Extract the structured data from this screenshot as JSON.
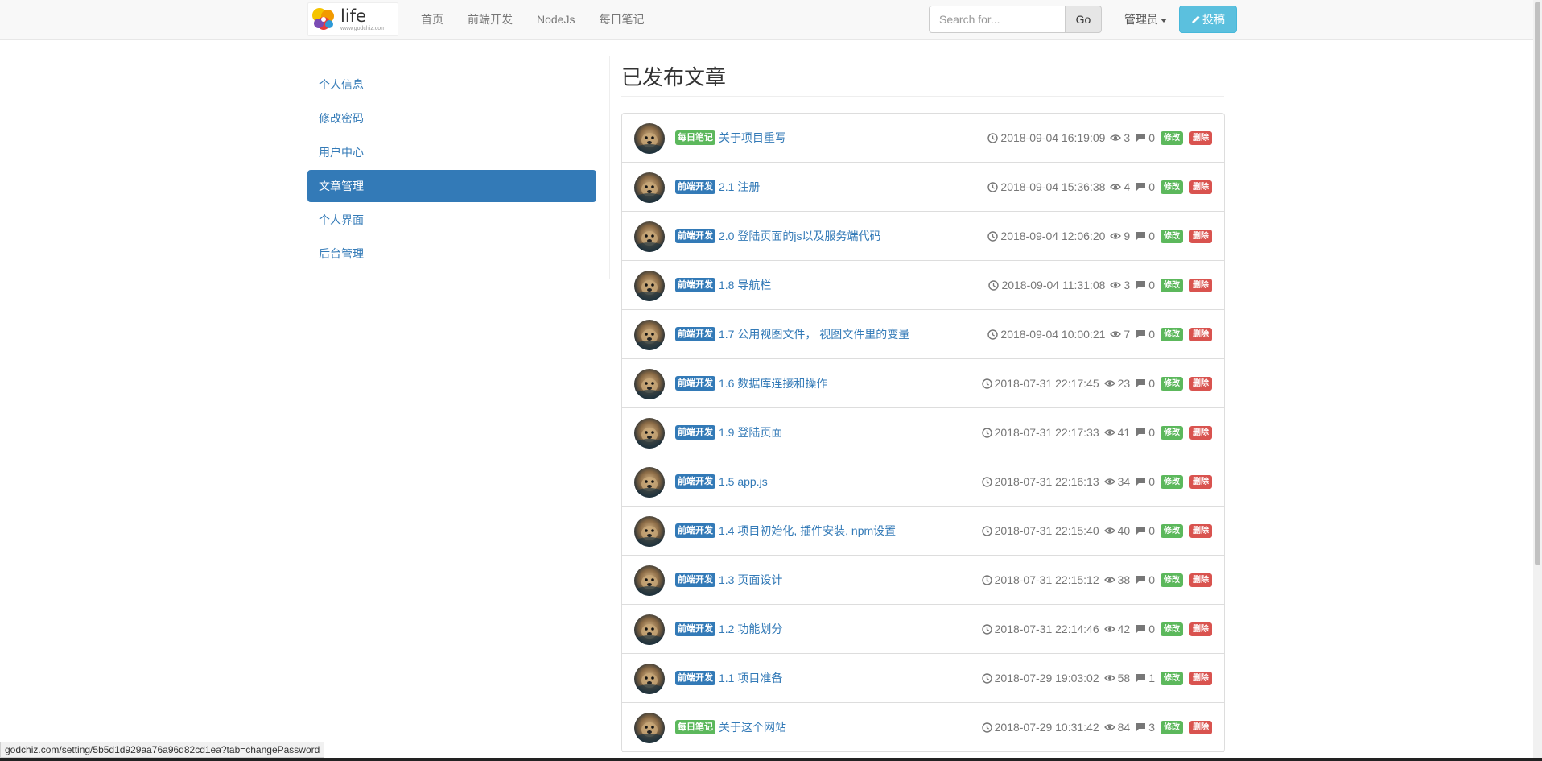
{
  "navbar": {
    "logo_text": "life",
    "logo_sub": "www.godchiz.com",
    "links": [
      "首页",
      "前端开发",
      "NodeJs",
      "每日笔记"
    ],
    "search_placeholder": "Search for...",
    "go_label": "Go",
    "admin_label": "管理员",
    "post_label": "投稿"
  },
  "sidebar": {
    "items": [
      {
        "label": "个人信息"
      },
      {
        "label": "修改密码"
      },
      {
        "label": "用户中心"
      },
      {
        "label": "文章管理",
        "active": true
      },
      {
        "label": "个人界面"
      },
      {
        "label": "后台管理"
      }
    ]
  },
  "main": {
    "title": "已发布文章",
    "edit_label": "修改",
    "delete_label": "删除",
    "posts": [
      {
        "category": "每日笔记",
        "cat_color": "green",
        "title": "关于项目重写",
        "date": "2018-09-04 16:19:09",
        "views": "3",
        "comments": "0"
      },
      {
        "category": "前端开发",
        "cat_color": "blue",
        "title": "2.1 注册",
        "date": "2018-09-04 15:36:38",
        "views": "4",
        "comments": "0"
      },
      {
        "category": "前端开发",
        "cat_color": "blue",
        "title": "2.0 登陆页面的js以及服务端代码",
        "date": "2018-09-04 12:06:20",
        "views": "9",
        "comments": "0"
      },
      {
        "category": "前端开发",
        "cat_color": "blue",
        "title": "1.8 导航栏",
        "date": "2018-09-04 11:31:08",
        "views": "3",
        "comments": "0"
      },
      {
        "category": "前端开发",
        "cat_color": "blue",
        "title": "1.7 公用视图文件， 视图文件里的变量",
        "date": "2018-09-04 10:00:21",
        "views": "7",
        "comments": "0"
      },
      {
        "category": "前端开发",
        "cat_color": "blue",
        "title": "1.6 数据库连接和操作",
        "date": "2018-07-31 22:17:45",
        "views": "23",
        "comments": "0"
      },
      {
        "category": "前端开发",
        "cat_color": "blue",
        "title": "1.9 登陆页面",
        "date": "2018-07-31 22:17:33",
        "views": "41",
        "comments": "0"
      },
      {
        "category": "前端开发",
        "cat_color": "blue",
        "title": "1.5 app.js",
        "date": "2018-07-31 22:16:13",
        "views": "34",
        "comments": "0"
      },
      {
        "category": "前端开发",
        "cat_color": "blue",
        "title": "1.4 项目初始化, 插件安装, npm设置",
        "date": "2018-07-31 22:15:40",
        "views": "40",
        "comments": "0"
      },
      {
        "category": "前端开发",
        "cat_color": "blue",
        "title": "1.3 页面设计",
        "date": "2018-07-31 22:15:12",
        "views": "38",
        "comments": "0"
      },
      {
        "category": "前端开发",
        "cat_color": "blue",
        "title": "1.2 功能划分",
        "date": "2018-07-31 22:14:46",
        "views": "42",
        "comments": "0"
      },
      {
        "category": "前端开发",
        "cat_color": "blue",
        "title": "1.1 项目准备",
        "date": "2018-07-29 19:03:02",
        "views": "58",
        "comments": "1"
      },
      {
        "category": "每日笔记",
        "cat_color": "green",
        "title": "关于这个网站",
        "date": "2018-07-29 10:31:42",
        "views": "84",
        "comments": "3"
      }
    ]
  },
  "statusbar": {
    "url": "godchiz.com/setting/5b5d1d929aa76a96d82cd1ea?tab=changePassword"
  },
  "colors": {
    "primary": "#337ab7",
    "success": "#5cb85c",
    "danger": "#d9534f",
    "info": "#5bc0de"
  },
  "icons": {
    "search": "search-icon",
    "pencil": "pencil-icon",
    "clock": "clock-icon",
    "eye": "eye-icon",
    "comment": "comment-icon",
    "caret": "caret-down-icon"
  }
}
